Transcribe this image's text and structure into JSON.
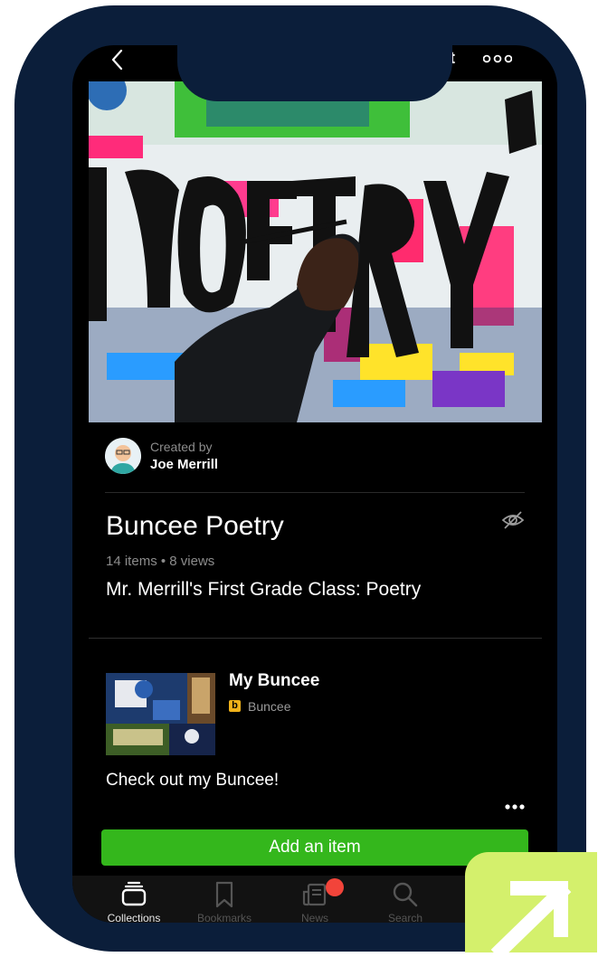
{
  "nav": {
    "back_icon": "chevron-left-icon",
    "edit_label": "it",
    "more_icon": "ellipsis-icon"
  },
  "hero": {
    "alt_icon": "poetry-graffiti-image"
  },
  "creator": {
    "created_by_label": "Created by",
    "name": "Joe Merrill"
  },
  "collection": {
    "title": "Buncee Poetry",
    "meta": "14 items • 8 views",
    "description": "Mr. Merrill's First Grade Class: Poetry",
    "visibility_icon": "eye-slash-icon"
  },
  "item": {
    "title": "My Buncee",
    "source_badge": "b",
    "source": "Buncee",
    "caption": "Check out my Buncee!",
    "more_icon": "ellipsis-icon"
  },
  "actions": {
    "add_item_label": "Add an item"
  },
  "tabs": [
    {
      "label": "Collections",
      "icon": "collections-icon",
      "active": true
    },
    {
      "label": "Bookmarks",
      "icon": "bookmark-icon",
      "active": false
    },
    {
      "label": "News",
      "icon": "news-icon",
      "active": false
    },
    {
      "label": "Search",
      "icon": "search-icon",
      "active": false
    }
  ],
  "colors": {
    "frame": "#0b1e3a",
    "accent_green": "#34b71c",
    "badge_red": "#f2443a",
    "corner": "#d4f06c"
  }
}
